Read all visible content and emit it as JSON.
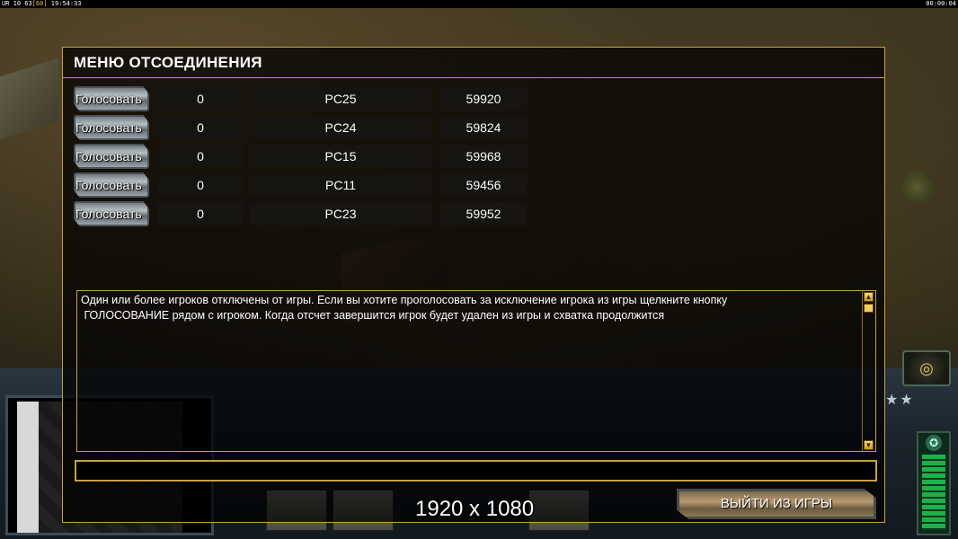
{
  "topbar": {
    "left_text": "UR 10 63",
    "left_highlight": "[60]",
    "left_time": "19:54:33",
    "right_time": "00:00:04"
  },
  "dialog": {
    "title": "МЕНЮ ОТСОЕДИНЕНИЯ",
    "players": [
      {
        "vote_label": "Голосовать",
        "votes": "0",
        "name": "PC25",
        "ping": "59920"
      },
      {
        "vote_label": "Голосовать",
        "votes": "0",
        "name": "PC24",
        "ping": "59824"
      },
      {
        "vote_label": "Голосовать",
        "votes": "0",
        "name": "PC15",
        "ping": "59968"
      },
      {
        "vote_label": "Голосовать",
        "votes": "0",
        "name": "PC11",
        "ping": "59456"
      },
      {
        "vote_label": "Голосовать",
        "votes": "0",
        "name": "PC23",
        "ping": "59952"
      }
    ],
    "message": "Один или более игроков отключены от игры. Если вы хотите проголосовать за исключение игрока из игры щелкните кнопку\n ГОЛОСОВАНИЕ рядом с игроком. Когда отсчет завершится игрок будет удален из игры и схватка продолжится",
    "chat_value": "",
    "exit_label": "ВЫЙТИ ИЗ ИГРЫ"
  },
  "overlay": {
    "resolution_label": "1920 x 1080"
  },
  "icons": {
    "scroll_up": "scroll-up-arrow-icon",
    "scroll_down": "scroll-down-arrow-icon",
    "radar": "radar-icon",
    "general": "general-star-icon"
  },
  "colors": {
    "dialog_border": "#c8a040",
    "dialog_bg": "#000000",
    "text": "#ffffff",
    "power_bar": "#1fb04c"
  }
}
